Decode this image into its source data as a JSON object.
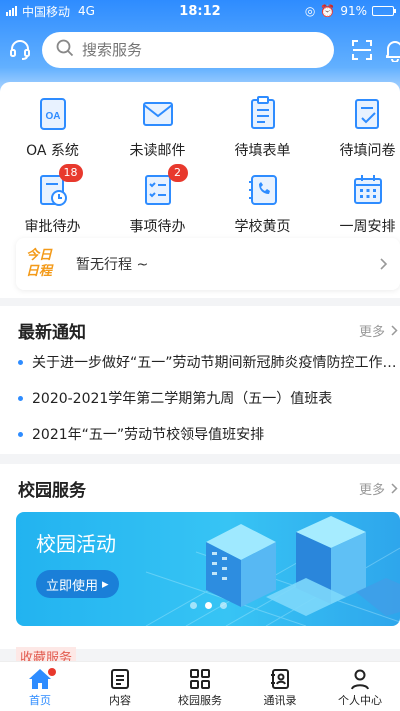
{
  "status": {
    "carrier": "中国移动",
    "network": "4G",
    "time": "18:12",
    "battery": "91%"
  },
  "search": {
    "placeholder": "搜索服务"
  },
  "quick": [
    {
      "label": "OA 系统",
      "icon": "oa-icon"
    },
    {
      "label": "未读邮件",
      "icon": "mail-icon"
    },
    {
      "label": "待填表单",
      "icon": "form-icon"
    },
    {
      "label": "待填问卷",
      "icon": "survey-icon"
    },
    {
      "label": "审批待办",
      "icon": "approval-icon",
      "badge": "18"
    },
    {
      "label": "事项待办",
      "icon": "task-icon",
      "badge": "2"
    },
    {
      "label": "学校黄页",
      "icon": "phone-book-icon"
    },
    {
      "label": "一周安排",
      "icon": "calendar-icon"
    }
  ],
  "schedule": {
    "tag_line1": "今日",
    "tag_line2": "日程",
    "text": "暂无行程 ~"
  },
  "notice": {
    "title": "最新通知",
    "more": "更多",
    "items": [
      "关于进一步做好“五一”劳动节期间新冠肺炎疫情防控工作的通知",
      "2020-2021学年第二学期第九周（五一）值班表",
      "2021年“五一”劳动节校领导值班安排"
    ]
  },
  "campus": {
    "title": "校园服务",
    "more": "更多",
    "banner_title": "校园活动",
    "banner_button": "立即使用"
  },
  "favorites": {
    "label": "收藏服务"
  },
  "tabs": [
    {
      "label": "首页",
      "icon": "home-icon"
    },
    {
      "label": "内容",
      "icon": "content-icon"
    },
    {
      "label": "校园服务",
      "icon": "apps-icon"
    },
    {
      "label": "通讯录",
      "icon": "contacts-icon"
    },
    {
      "label": "个人中心",
      "icon": "user-icon"
    }
  ],
  "colors": {
    "primary": "#2e8cff",
    "badge": "#e8392d",
    "accent_orange": "#f39a19"
  }
}
